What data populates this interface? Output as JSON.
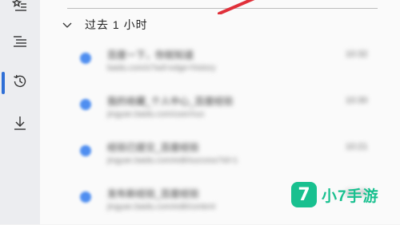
{
  "rail": {
    "items": [
      {
        "icon": "favorites-icon"
      },
      {
        "icon": "reading-list-icon"
      },
      {
        "icon": "history-icon",
        "active": true
      },
      {
        "icon": "downloads-icon"
      }
    ]
  },
  "history": {
    "group_title": "过去 1 小时",
    "items": [
      {
        "title": "百度一下，你就知道",
        "url": "baidu.com/s?wd=edge+history",
        "time": "10:32"
      },
      {
        "title": "我的收藏_个人中心_百度经验",
        "url": "jingyan.baidu.com/user/nuc",
        "time": "10:30"
      },
      {
        "title": "经验已提交_百度经验",
        "url": "jingyan.baidu.com/edit/success?id=1",
        "time": "10:21"
      },
      {
        "title": "发布新经验_百度经验",
        "url": "jingyan.baidu.com/edit/content",
        "time": "10:15"
      }
    ]
  },
  "watermark": {
    "logo_glyph": "7",
    "text": "小7手游",
    "color": "#18c08f"
  },
  "colors": {
    "accent": "#2f6fd6",
    "favicon": "#4f8ef0",
    "annotation": "#e0303a"
  }
}
